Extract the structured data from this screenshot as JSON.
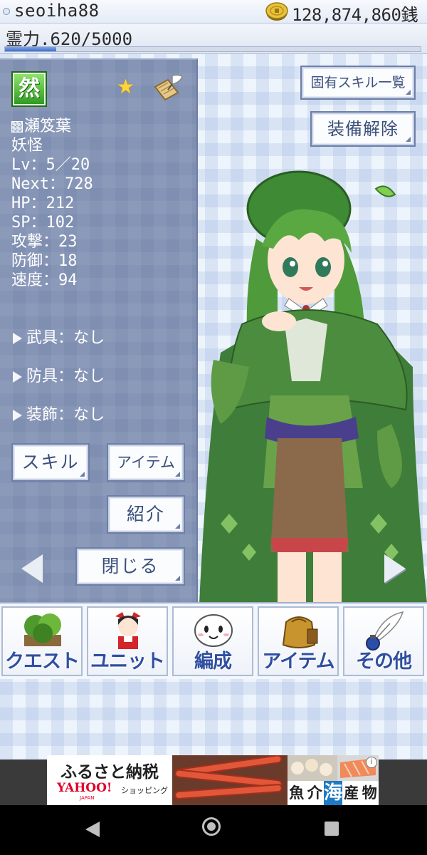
{
  "header": {
    "username": "seoiha88",
    "money": "128,874,860銭",
    "spirit_text": "霊力.620/5000",
    "spirit_fraction": 0.124
  },
  "character": {
    "attribute": "然",
    "name": "瀬笈葉",
    "race": "妖怪",
    "stats": {
      "lv": "Lv：5／20",
      "next": "Next：728",
      "hp": "HP：212",
      "sp": "SP：102",
      "attack": "攻撃：23",
      "defense": "防御：18",
      "speed": "速度：94"
    },
    "equipment": {
      "weapon": "武具：なし",
      "armor": "防具：なし",
      "accessory": "装飾：なし"
    }
  },
  "buttons": {
    "unique_skills": "固有スキル一覧",
    "unequip": "装備解除",
    "skill": "スキル",
    "item": "アイテム",
    "intro": "紹介",
    "close": "閉じる"
  },
  "nav": [
    {
      "label": "クエスト",
      "icon": "forest-icon"
    },
    {
      "label": "ユニット",
      "icon": "shrine-maiden-icon"
    },
    {
      "label": "編成",
      "icon": "yukkuri-face-icon"
    },
    {
      "label": "アイテム",
      "icon": "pouch-icon"
    },
    {
      "label": "その他",
      "icon": "quill-ink-icon"
    }
  ],
  "ad": {
    "title": "ふるさと納税",
    "brand": "YAHOO!",
    "brand_sub": "JAPAN",
    "shopping": "ショッピング",
    "seafood": [
      "魚",
      "介",
      "海",
      "産",
      "物"
    ],
    "info": "i"
  },
  "colors": {
    "panel": "#7f8fb2",
    "attribute_green": "#2f9b22",
    "nav_label": "#2f4fa0"
  }
}
